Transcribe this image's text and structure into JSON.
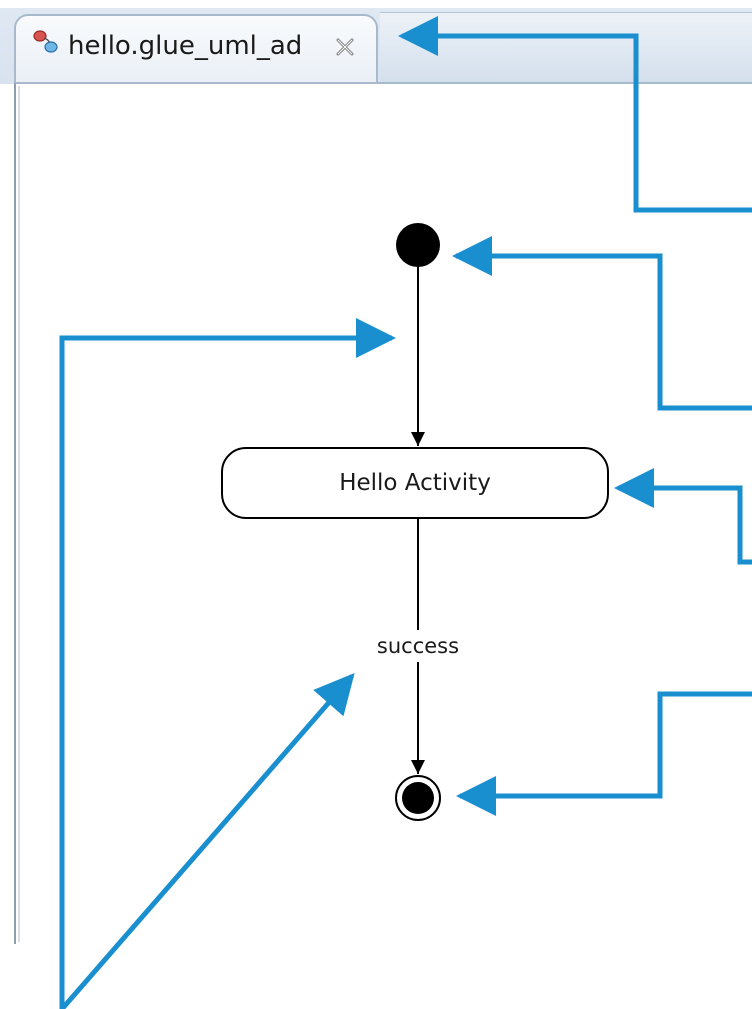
{
  "editor_tab": {
    "title": "hello.glue_uml_ad",
    "icon": "activity-diagram-icon",
    "close_icon": "close-icon"
  },
  "diagram": {
    "action_label": "Hello Activity",
    "transition_label": "success"
  },
  "colors": {
    "callout_arrow": "#1a8fd0",
    "tab_border": "#a9b9cc",
    "diagram_stroke": "#000000"
  }
}
